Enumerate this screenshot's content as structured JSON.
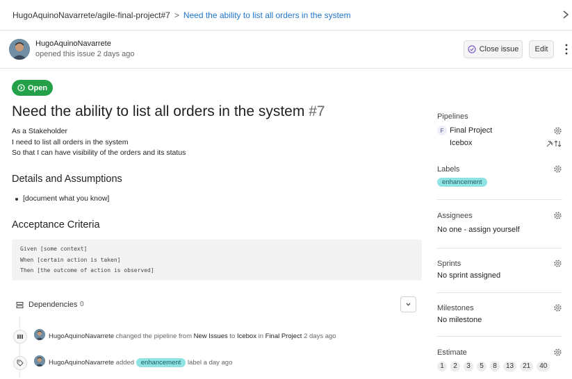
{
  "breadcrumb": {
    "project": "HugoAquinoNavarrete/agile-final-project#7",
    "separator": ">",
    "current": "Need the ability to list all orders in the system"
  },
  "header": {
    "author": "HugoAquinoNavarrete",
    "opened": "opened this issue 2 days ago",
    "close_label": "Close issue",
    "edit_label": "Edit"
  },
  "issue": {
    "status": "Open",
    "title": "Need the ability to list all orders in the system",
    "number": "#7",
    "description": [
      "As a Stakeholder",
      "I need to list all orders in the system",
      "So that I can have visibility of the orders and its status"
    ],
    "details_heading": "Details and Assumptions",
    "details_items": [
      "[document what you know]"
    ],
    "acceptance_heading": "Acceptance Criteria",
    "acceptance_code": [
      "Given [some context]",
      "When [certain action is taken]",
      "Then [the outcome of action is observed]"
    ],
    "dependencies_label": "Dependencies",
    "dependencies_count": "0"
  },
  "activity": [
    {
      "user": "HugoAquinoNavarrete",
      "t1": "changed the pipeline from",
      "from": "New Issues",
      "t2": "to",
      "to": "Icebox",
      "t3": "in",
      "board": "Final Project",
      "when": "2 days ago"
    },
    {
      "user": "HugoAquinoNavarrete",
      "t1": "added",
      "label": "enhancement",
      "t2": "label a day ago"
    }
  ],
  "sidebar": {
    "pipelines_title": "Pipelines",
    "pipeline_initial": "F",
    "pipeline_board": "Final Project",
    "pipeline_stage": "Icebox",
    "labels_title": "Labels",
    "label": "enhancement",
    "assignees_title": "Assignees",
    "assignees_none": "No one -",
    "assign_link": "assign yourself",
    "sprints_title": "Sprints",
    "sprints_value": "No sprint assigned",
    "milestones_title": "Milestones",
    "milestones_value": "No milestone",
    "estimate_title": "Estimate",
    "estimates": [
      "1",
      "2",
      "3",
      "5",
      "8",
      "13",
      "21",
      "40"
    ]
  },
  "colors": {
    "open_badge": "#24a148",
    "link": "#1f75cb",
    "label_bg": "#8fe3e3"
  }
}
